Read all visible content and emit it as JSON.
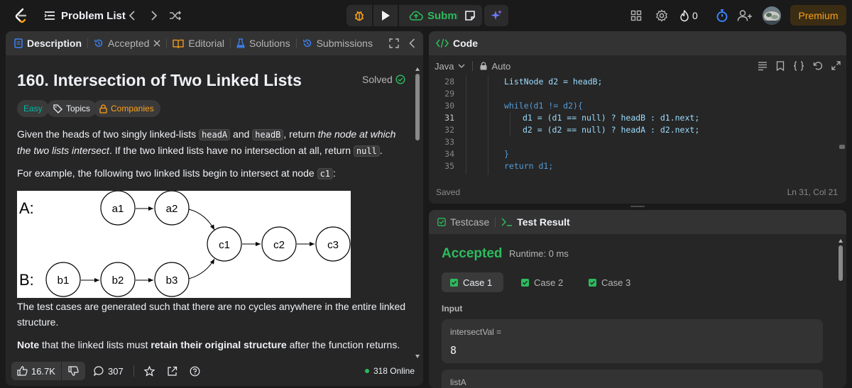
{
  "topbar": {
    "problem_list_label": "Problem List",
    "submit_label": "Submit",
    "fire_count": "0",
    "premium_label": "Premium"
  },
  "description_panel": {
    "tabs": [
      {
        "label": "Description",
        "icon": "description-icon",
        "active": true
      },
      {
        "label": "Accepted",
        "icon": "history-icon",
        "closable": true
      },
      {
        "label": "Editorial",
        "icon": "book-icon"
      },
      {
        "label": "Solutions",
        "icon": "flask-icon"
      },
      {
        "label": "Submissions",
        "icon": "history-icon"
      }
    ],
    "title": "160. Intersection of Two Linked Lists",
    "solved_label": "Solved",
    "chips": {
      "difficulty": "Easy",
      "topics": "Topics",
      "companies": "Companies"
    },
    "p1": {
      "a": "Given the heads of two singly linked-lists ",
      "code1": "headA",
      "b": " and ",
      "code2": "headB",
      "c": ", return ",
      "em": "the node at which the two lists intersect",
      "d": ". If the two linked lists have no intersection at all, return ",
      "code3": "null",
      "e": "."
    },
    "p2": {
      "a": "For example, the following two linked lists begin to intersect at node ",
      "code": "c1",
      "b": ":"
    },
    "diagram": {
      "label_a": "A:",
      "label_b": "B:",
      "nodes_a": [
        "a1",
        "a2"
      ],
      "nodes_b": [
        "b1",
        "b2",
        "b3"
      ],
      "nodes_shared": [
        "c1",
        "c2",
        "c3"
      ]
    },
    "p3": "The test cases are generated such that there are no cycles anywhere in the entire linked structure.",
    "p4": {
      "bold1": "Note",
      "a": " that the linked lists must ",
      "bold2": "retain their original structure",
      "b": " after the function returns."
    },
    "footer": {
      "likes": "16.7K",
      "comments": "307",
      "online": "318 Online"
    }
  },
  "code_panel": {
    "title": "Code",
    "language": "Java",
    "mode": "Auto",
    "lines": [
      {
        "n": "28"
      },
      {
        "n": "29"
      },
      {
        "n": "30"
      },
      {
        "n": "31"
      },
      {
        "n": "32"
      },
      {
        "n": "33"
      },
      {
        "n": "34"
      },
      {
        "n": "35"
      }
    ],
    "code": {
      "l28": "ListNode d2 = headB;",
      "l30": "while(d1 != d2){",
      "l31": "d1 = (d1 == null) ? headB : d1.next;",
      "l32": "d2 = (d2 == null) ? headA : d2.next;",
      "l34": "}",
      "l35": "return d1;"
    },
    "status_left": "Saved",
    "status_right": "Ln 31, Col 21"
  },
  "result_panel": {
    "tabs": [
      {
        "label": "Testcase",
        "icon": "checkbox-icon"
      },
      {
        "label": "Test Result",
        "icon": "terminal-icon",
        "active": true
      }
    ],
    "status": "Accepted",
    "runtime": "Runtime: 0 ms",
    "cases": [
      {
        "label": "Case 1",
        "active": true
      },
      {
        "label": "Case 2"
      },
      {
        "label": "Case 3"
      }
    ],
    "input_label": "Input",
    "vars": [
      {
        "name": "intersectVal =",
        "value": "8"
      },
      {
        "name": "listA"
      }
    ]
  },
  "colors": {
    "accent_green": "#2cbb5d",
    "accent_orange": "#ffa116",
    "easy_teal": "#00b8a3"
  }
}
